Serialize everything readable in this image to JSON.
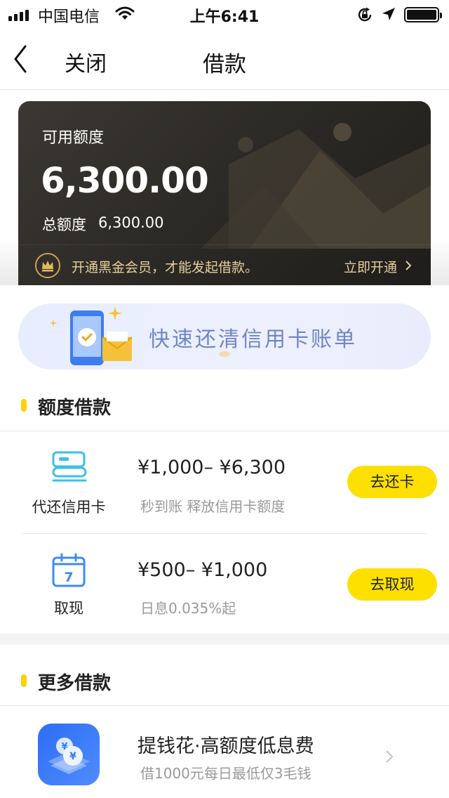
{
  "status_bar": {
    "carrier": "中国电信",
    "time": "上午6:41"
  },
  "nav": {
    "close_label": "关闭",
    "title": "借款"
  },
  "credit_card": {
    "available_label": "可用额度",
    "available_amount": "6,300.00",
    "total_label": "总额度",
    "total_amount": "6,300.00",
    "vip_text": "开通黑金会员，才能发起借款。",
    "vip_link": "立即开通"
  },
  "banner": {
    "text": "快速还清信用卡账单"
  },
  "quota_section": {
    "title": "额度借款",
    "items": [
      {
        "name": "代还信用卡",
        "range": "¥1,000– ¥6,300",
        "desc": "秒到账 释放信用卡额度",
        "button": "去还卡",
        "icon": "credit-card-icon"
      },
      {
        "name": "取现",
        "range": "¥500– ¥1,000",
        "desc": "日息0.035%起",
        "button": "去取现",
        "icon": "calendar-icon",
        "icon_day": "7"
      }
    ]
  },
  "more_section": {
    "title": "更多借款",
    "items": [
      {
        "title": "提钱花·高额度低息费",
        "desc": "借1000元每日最低仅3毛钱",
        "icon": "coin-stack-icon"
      }
    ]
  },
  "colors": {
    "accent_yellow": "#fde000",
    "card_dark": "#2a2824",
    "gold_text": "#e6cf9c",
    "muted_text": "#9a9a9a",
    "brand_blue": "#2d6df3"
  }
}
